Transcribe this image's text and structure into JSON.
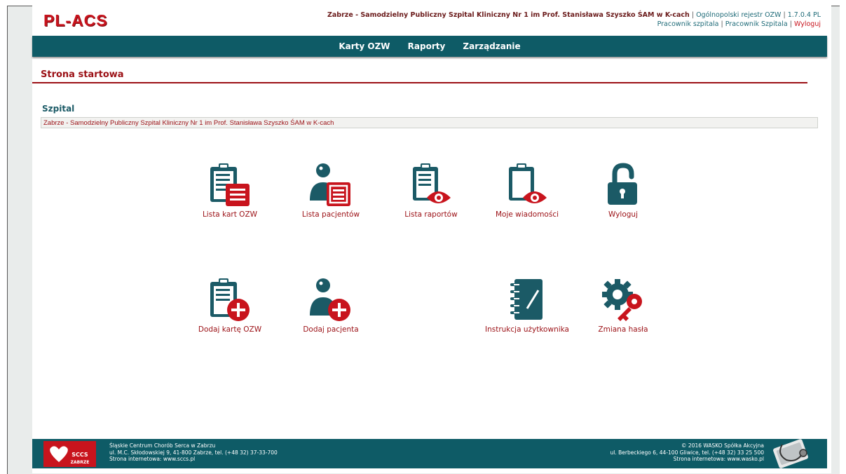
{
  "header": {
    "logo": "PL-ACS",
    "hospital_name": "Zabrze - Samodzielny Publiczny Szpital Kliniczny Nr 1 im Prof. Stanisława Szyszko ŚAM w K-cach",
    "registry": "Ogólnopolski rejestr OZW",
    "version": "1.7.0.4 PL",
    "user_role": "Pracownik szpitala",
    "user_name": "Pracownik Szpitala",
    "logout": "Wyloguj",
    "separator": "|"
  },
  "nav": {
    "items": [
      {
        "label": "Karty OZW"
      },
      {
        "label": "Raporty"
      },
      {
        "label": "Zarządzanie"
      }
    ]
  },
  "page": {
    "title": "Strona startowa",
    "section_title": "Szpital",
    "hospital_value": "Zabrze - Samodzielny Publiczny Szpital Kliniczny Nr 1 im Prof. Stanisława Szyszko ŚAM w K-cach"
  },
  "tiles": {
    "lista_kart": {
      "label": "Lista kart OZW",
      "icon": "clipboard-list-icon"
    },
    "lista_pacjentow": {
      "label": "Lista pacjentów",
      "icon": "patient-list-icon"
    },
    "lista_raportow": {
      "label": "Lista raportów",
      "icon": "clipboard-eye-list-icon"
    },
    "moje_wiadomosci": {
      "label": "Moje wiadomości",
      "icon": "clipboard-eye-icon"
    },
    "wyloguj": {
      "label": "Wyloguj",
      "icon": "unlock-icon"
    },
    "dodaj_karte": {
      "label": "Dodaj kartę OZW",
      "icon": "clipboard-add-icon"
    },
    "dodaj_pacjenta": {
      "label": "Dodaj pacjenta",
      "icon": "patient-add-icon"
    },
    "instrukcja": {
      "label": "Instrukcja użytkownika",
      "icon": "notebook-icon"
    },
    "zmiana_hasla": {
      "label": "Zmiana hasła",
      "icon": "gear-key-icon"
    }
  },
  "footer": {
    "left_line1": "Śląskie Centrum Chorób Serca w Zabrzu",
    "left_line2": "ul. M.C. Skłodowskiej 9, 41-800 Zabrze, tel. (+48 32) 37-33-700",
    "left_line3": "Strona internetowa: www.sccs.pl",
    "right_line1": "© 2016 WASKO Spółka Akcyjna",
    "right_line2": "ul. Berbeckiego 6, 44-100 Gliwice, tel. (+48 32) 33 25 500",
    "right_line3": "Strona internetowa: www.wasko.pl",
    "sccs_logo_text_1": "SCCS",
    "sccs_logo_text_2": "ZABRZE"
  },
  "colors": {
    "teal": "#0e5b66",
    "dark_red": "#9b1015",
    "brand_red": "#c8141d",
    "icon_teal": "#1b5a66",
    "icon_red": "#c8141d"
  }
}
